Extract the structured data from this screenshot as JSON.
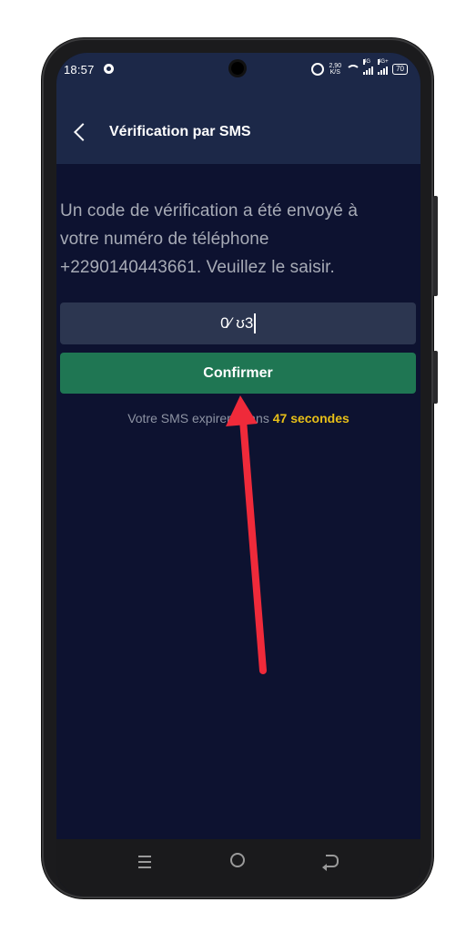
{
  "status_bar": {
    "time": "18:57",
    "speed_value": "2,90",
    "speed_unit": "K/S",
    "network_1": "4G",
    "network_2": "4G+",
    "battery": "70"
  },
  "header": {
    "title": "Vérification par SMS",
    "back_icon": "chevron-left-icon"
  },
  "main": {
    "instruction": "Un code de vérification a été envoyé à votre numéro de téléphone +2290140443661. Veuillez le saisir.",
    "code_value": "0⁄ ʊ3",
    "confirm_label": "Confirmer",
    "expiry_prefix": "Votre SMS expirera dans ",
    "expiry_countdown": "47 secondes"
  },
  "colors": {
    "background": "#0d1230",
    "header": "#1c2848",
    "input": "#2c3650",
    "button": "#1f7653",
    "countdown": "#e7bf18",
    "annotation_arrow": "#ef2a3a"
  },
  "nav_bar": {
    "icons": [
      "menu-icon",
      "home-icon",
      "back-icon"
    ]
  }
}
